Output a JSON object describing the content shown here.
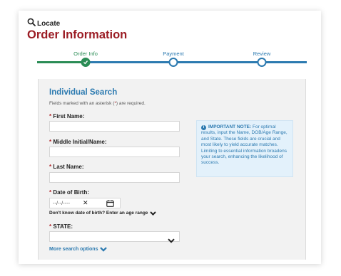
{
  "app": {
    "brand": "Locate",
    "title": "Order Information"
  },
  "colors": {
    "title": "#9b1c24",
    "accent": "#2c7ab0",
    "done": "#2a8c55",
    "required": "#b0262b"
  },
  "steps": [
    {
      "label": "Order Info",
      "state": "done"
    },
    {
      "label": "Payment",
      "state": "pending"
    },
    {
      "label": "Review",
      "state": "pending"
    }
  ],
  "form": {
    "section_title": "Individual Search",
    "required_note_before": "Fields marked with an asterisk (",
    "required_note_ast": "*",
    "required_note_after": ") are required.",
    "asterisk": "*",
    "first_name_label": "First Name:",
    "first_name_value": "",
    "middle_name_label": "Middle Initial/Name:",
    "middle_name_value": "",
    "last_name_label": "Last Name:",
    "last_name_value": "",
    "dob_label": "Date of Birth:",
    "dob_placeholder": "--/--/----",
    "dob_clear": "✕",
    "age_range_link": "Don't know date of birth? Enter an age range",
    "state_label": "STATE:",
    "state_value": "",
    "more_options_link": "More search options"
  },
  "note": {
    "icon": "info-icon",
    "heading": "IMPORTANT NOTE:",
    "body": "For optimal results, input the Name, DOB/Age Range, and State. These fields are crucial and most likely to yield accurate matches. Limiting to essential information broadens your search, enhancing the likelihood of success."
  }
}
